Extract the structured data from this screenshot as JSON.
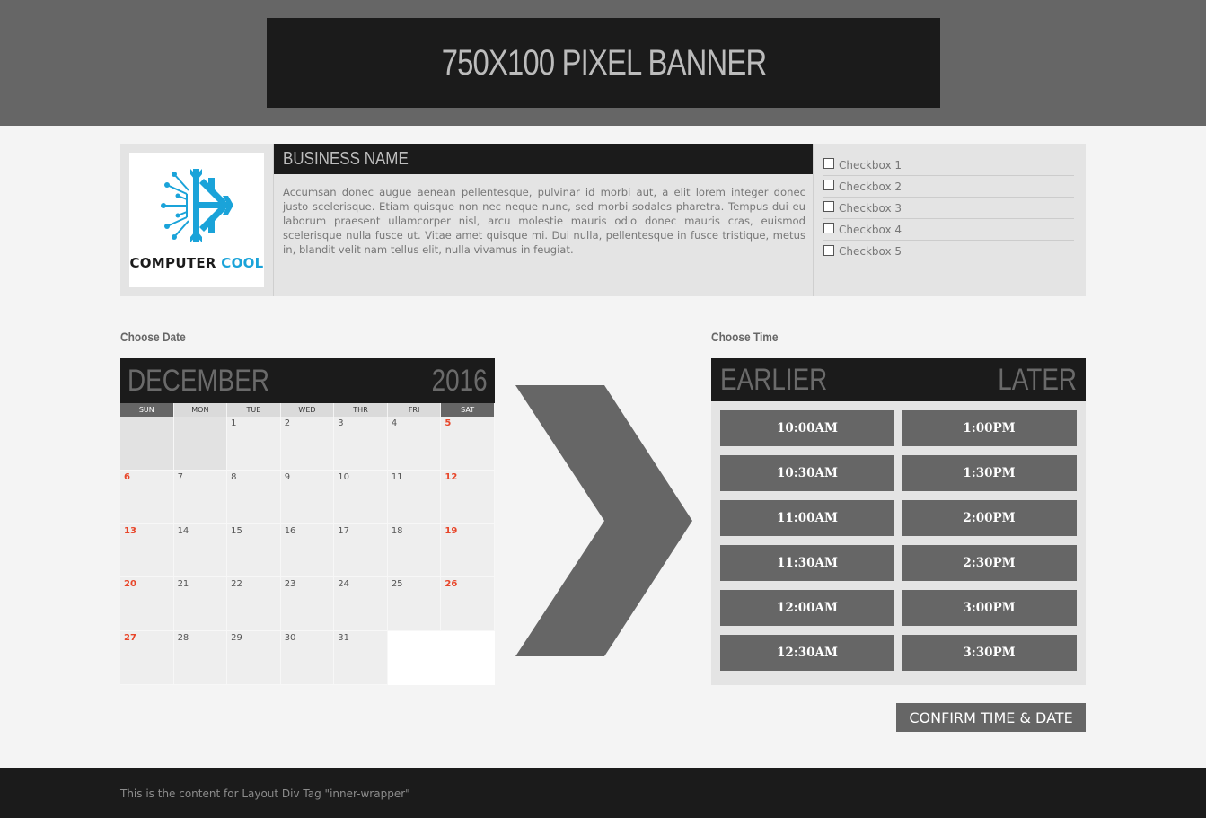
{
  "banner": {
    "text": "750X100 PIXEL BANNER"
  },
  "business": {
    "logo_text_1": "COMPUTER",
    "logo_text_2": "COOL",
    "name": "BUSINESS NAME",
    "description": "Accumsan donec augue aenean pellentesque, pulvinar id morbi aut, a elit lorem integer donec justo scelerisque. Etiam quisque non nec neque nunc, sed morbi sodales pharetra. Tempus dui eu laborum praesent ullamcorper nisl, arcu molestie mauris odio donec mauris cras, euismod scelerisque nulla fusce ut. Vitae amet quisque mi. Dui nulla, pellentesque in fusce tristique, metus in, blandit velit nam tellus elit, nulla vivamus in feugiat.",
    "checkboxes": [
      "Checkbox 1",
      "Checkbox 2",
      "Checkbox 3",
      "Checkbox 4",
      "Checkbox 5"
    ]
  },
  "date_picker": {
    "label": "Choose Date",
    "month": "DECEMBER",
    "year": "2016",
    "weekdays": [
      "SUN",
      "MON",
      "TUE",
      "WED",
      "THR",
      "FRI",
      "SAT"
    ],
    "cells": [
      "",
      "",
      "1",
      "2",
      "3",
      "4",
      "5",
      "6",
      "7",
      "8",
      "9",
      "10",
      "11",
      "12",
      "13",
      "14",
      "15",
      "16",
      "17",
      "18",
      "19",
      "20",
      "21",
      "22",
      "23",
      "24",
      "25",
      "26",
      "27",
      "28",
      "29",
      "30",
      "31",
      "",
      ""
    ]
  },
  "time_picker": {
    "label": "Choose Time",
    "earlier": "EARLIER",
    "later": "LATER",
    "slots": [
      "10:00AM",
      "1:00PM",
      "10:30AM",
      "1:30PM",
      "11:00AM",
      "2:00PM",
      "11:30AM",
      "2:30PM",
      "12:00AM",
      "3:00PM",
      "12:30AM",
      "3:30PM"
    ]
  },
  "confirm_label": "CONFIRM TIME & DATE",
  "footer": {
    "text": "This is the content for Layout Div Tag \"inner-wrapper\""
  },
  "icons": {
    "arrow": "chevron-right-icon",
    "logo": "snowflake-circuit-icon"
  },
  "colors": {
    "accent": "#1aa3d9",
    "dark": "#1b1b1b",
    "slot": "#666666",
    "weekend": "#e8462a"
  }
}
